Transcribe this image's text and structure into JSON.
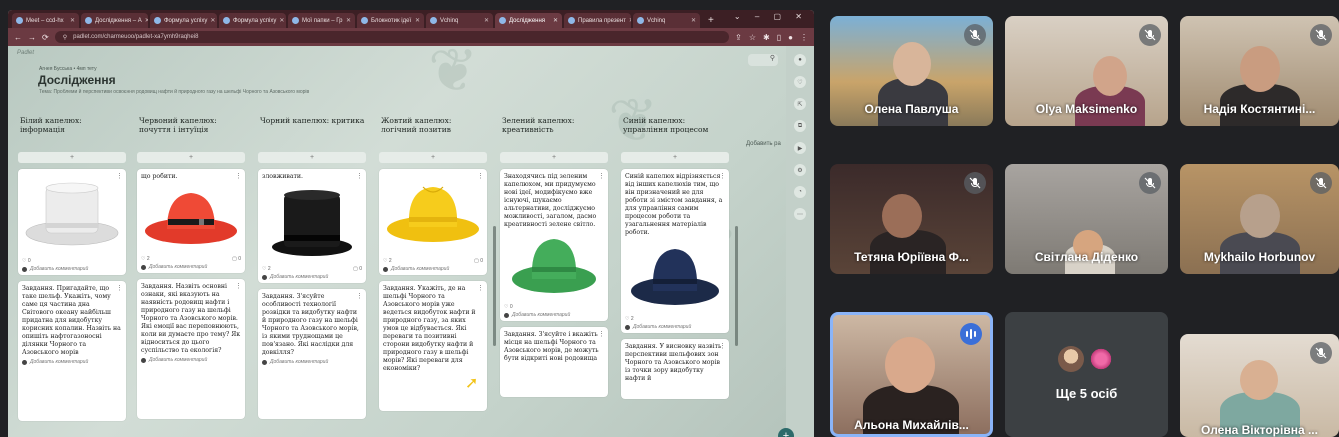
{
  "browser": {
    "tabs": [
      {
        "label": "Meet – ccd-hx"
      },
      {
        "label": "Дослідження – A"
      },
      {
        "label": "Формула успіху"
      },
      {
        "label": "Формула успіху"
      },
      {
        "label": "Мої папки – Гр"
      },
      {
        "label": "Блокнотик ідеї"
      },
      {
        "label": "Vchinq"
      },
      {
        "label": "Дослідження"
      },
      {
        "label": "Правила презент"
      },
      {
        "label": "Vchinq"
      }
    ],
    "url": "padlet.com/charmeuoo/padlet-xa7ymh9raqhei8"
  },
  "padlet": {
    "logo": "Padlet",
    "breadcrumb": "Агнея Бусська • 4мп тету",
    "title": "Дослідження",
    "subtitle": "Тема: Проблеми й перспективи освоєння родовищ нафти й природного газу на шельфі Чорного та Азовського морів",
    "add_column": "Добавить ра",
    "columns": [
      {
        "title": "Білий капелюх: інформація",
        "cards": [
          {
            "kind": "image",
            "hat": "white",
            "likes": "0",
            "comments": "",
            "comment_cta": "Добавить комментарий"
          },
          {
            "kind": "text",
            "text": "Завдання. Пригадайте, що таке шельф. Укажіть, чому саме ця частина дна Світового океану найбільш придатна для видобутку корисних копалин. Назвіть на опишіть нафтогазоносні ділянки Чорного та Азовського морів",
            "comment_cta": "Добавить комментарий"
          }
        ]
      },
      {
        "title": "Червоний капелюх: почуття і інтуїція",
        "cards": [
          {
            "kind": "image",
            "hat": "red",
            "top_text": "що робити.",
            "likes": "2",
            "comments": "0",
            "comment_cta": "Добавить комментарий"
          },
          {
            "kind": "text",
            "text": "Завдання. Назвіть основні ознаки, які вказують на наявність родовищ нафти і природного газу на шельфі Чорного та Азовського морів. Які емоції вас переповнюють, коли ви думаєте про тему? Як відноситься до цього суспільство та екологія?",
            "comment_cta": "Добавить комментарий"
          }
        ]
      },
      {
        "title": "Чорний капелюх: критика",
        "cards": [
          {
            "kind": "image",
            "hat": "black",
            "top_text": "зловживати.",
            "likes": "2",
            "comments": "0",
            "comment_cta": "Добавить комментарий"
          },
          {
            "kind": "text",
            "text": "Завдання. З'ясуйте особливості технології розвідки та видобутку нафти й природного газу на шельфі Чорного та Азовського морів, із якими труднощами це пов'язано. Які наслідки для довкілля?",
            "comment_cta": "Добавить комментарий"
          }
        ]
      },
      {
        "title": "Жовтий капелюх: логічний позитив",
        "cards": [
          {
            "kind": "image",
            "hat": "yellow",
            "likes": "2",
            "comments": "0",
            "comment_cta": "Добавить комментарий"
          },
          {
            "kind": "text",
            "text": "Завдання. Укажіть, де на шельфі Чорного та Азовського морів уже ведеться видобуток нафти й природного газу, за яких умов це відбувається. Які переваги та позитивні сторони видобутку нафти й природного газу в шельфі морів? Які переваги для економіки?",
            "comment_cta": ""
          }
        ]
      },
      {
        "title": "Зелений капелюх: креативність",
        "cards": [
          {
            "kind": "textimage",
            "hat": "green",
            "text": "Знаходячись під зеленим капелюхом, ми придумуємо нові ідеї, модифікуємо вже існуючі, шукаємо альтернативи, досліджуємо можливості, загалом, дасмо креативності зелене світло.",
            "likes": "0",
            "comments": "",
            "comment_cta": "Добавить комментарий"
          },
          {
            "kind": "text",
            "text": "Завдання. З'ясуйте і вкажіть місця на шельфі Чорного та Азовського морів, де можуть бути відкриті нові родовища",
            "comment_cta": ""
          }
        ]
      },
      {
        "title": "Синій капелюх: управління процесом",
        "cards": [
          {
            "kind": "textimage",
            "hat": "navy",
            "text": "Синій капелюх відрізняється від інших капелюхів тим, що він призначений не для роботи зі змістом завдання, а для управління самим процесом роботи та узагальнення матеріалів роботи.",
            "likes": "2",
            "comments": "",
            "comment_cta": "Добавить комментарий"
          },
          {
            "kind": "text",
            "text": "Завдання. У висновку назвіть перспективи шельфових зон Чорного та Азовського морів із точки зору видобутку нафти й",
            "comment_cta": ""
          }
        ]
      }
    ]
  },
  "participants": [
    {
      "name": "Олена Павлуша",
      "muted": true
    },
    {
      "name": "Olya Maksimenko",
      "muted": true
    },
    {
      "name": "Надія Костянтині...",
      "muted": true
    },
    {
      "name": "Тетяна Юріївна Ф...",
      "muted": true
    },
    {
      "name": "Світлана Діденко",
      "muted": true
    },
    {
      "name": "Mykhailo Horbunov",
      "muted": true
    },
    {
      "name": "Альона Михайлів...",
      "muted": false,
      "speaking": true
    },
    {
      "name": "Олена Вікторівна ...",
      "muted": true
    }
  ],
  "others": {
    "label": "Ще 5 осіб"
  },
  "colors": {
    "hat_white": "#e8e8e8",
    "hat_red": "#e23a2a",
    "hat_black": "#151515",
    "hat_yellow": "#f3c614",
    "hat_green": "#3aa353",
    "hat_navy": "#1f2d4d",
    "accent": "#3b6fd8"
  }
}
